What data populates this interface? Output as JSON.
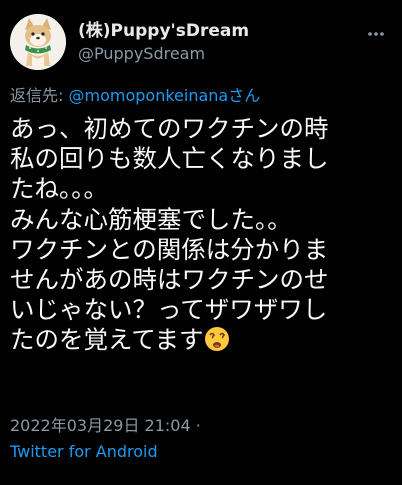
{
  "author": {
    "display_name": "(株)Puppy'sDream",
    "handle": "@PuppySdream",
    "avatar_icon": "shiba-dog-avatar-icon"
  },
  "reply": {
    "prefix": "返信先:",
    "mention": "@momoponkeinana",
    "suffix": "さん"
  },
  "tweet": {
    "lines": [
      "あっ、初めてのワクチンの時",
      "私の回りも数人亡くなりまし",
      "たね。。。",
      "みんな心筋梗塞でした。。",
      "ワクチンとの関係は分かりま",
      "せんがあの時はワクチンのせ",
      "いじゃない？ってザワザワし",
      "たのを覚えてます"
    ],
    "trailing_emoji": "dizzy-worried-face-emoji"
  },
  "meta": {
    "timestamp": "2022年03月29日 21:04",
    "separator": "·",
    "source": "Twitter for Android"
  },
  "colors": {
    "background": "#000000",
    "text": "#e7e9ea",
    "muted": "#8b98a5",
    "link": "#1d9bf0"
  }
}
